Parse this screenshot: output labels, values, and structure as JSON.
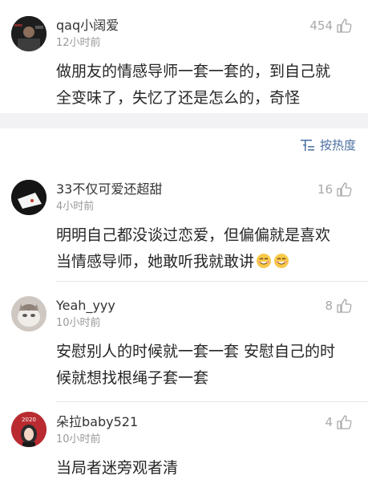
{
  "comments": [
    {
      "username": "qaq小阔爱",
      "time": "12小时前",
      "likes": "454",
      "text_line1": "做朋友的情感导师一套一套的，到自己就",
      "text_line2": "全变味了，失忆了还是怎么的，奇怪"
    },
    {
      "username": "33不仅可爱还超甜",
      "time": "4小时前",
      "likes": "16",
      "text_line1": "明明自己都没谈过恋爱，但偏偏就是喜欢",
      "text_line2": "当情感导师，她敢听我就敢讲"
    },
    {
      "username": "Yeah_yyy",
      "time": "10小时前",
      "likes": "8",
      "text_line1": "安慰别人的时候就一套一套 安慰自己的时",
      "text_line2": "候就想找根绳子套一套"
    },
    {
      "username": "朵拉baby521",
      "time": "10小时前",
      "likes": "4",
      "text_line1": "当局者迷旁观者清"
    }
  ],
  "sort": {
    "label": "按热度",
    "icon": "sort-list-icon"
  },
  "icons": {
    "like": "thumbs-up-icon",
    "emoji": "smiling-face-emoji"
  },
  "colors": {
    "accent": "#4a6fa0",
    "muted": "#9a9a9a",
    "band": "#f2f2f4"
  }
}
